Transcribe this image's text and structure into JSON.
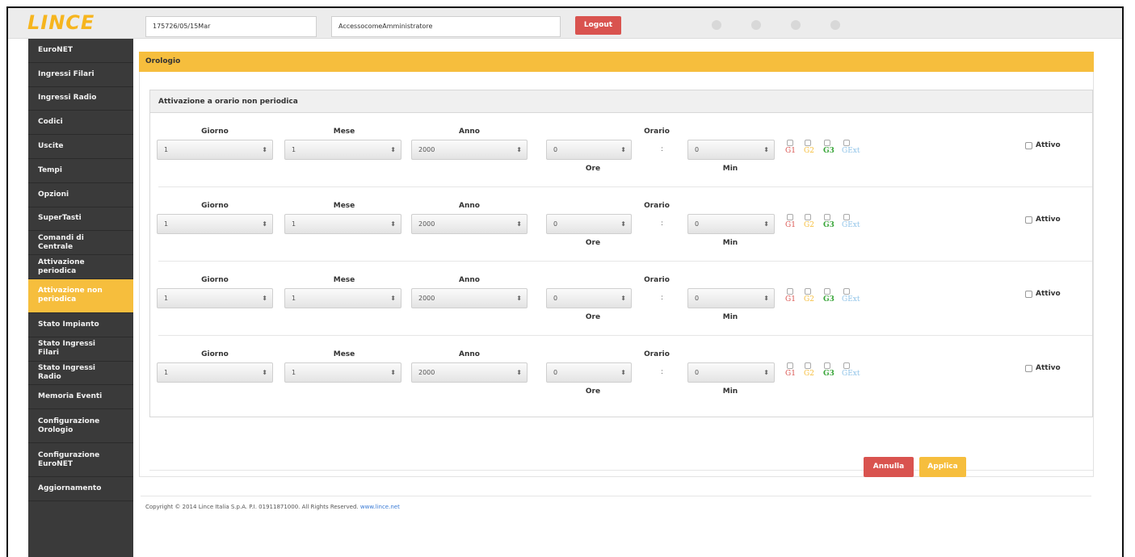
{
  "app": {
    "logo": "LINCE"
  },
  "header": {
    "field1": "175726/05/15Mar",
    "field2": "AccessocomeAmministratore",
    "logout_label": "Logout"
  },
  "sidebar": {
    "items": [
      "EuroNET",
      "Ingressi Filari",
      "Ingressi Radio",
      "Codici",
      "Uscite",
      "Tempi",
      "Opzioni",
      "SuperTasti",
      "Comandi di Centrale",
      "Attivazione periodica",
      "Attivazione non periodica",
      "Stato Impianto",
      "Stato Ingressi Filari",
      "Stato Ingressi Radio",
      "Memoria Eventi",
      "Configurazione Orologio",
      "Configurazione EuroNET",
      "Aggiornamento"
    ],
    "active_index": 10
  },
  "panel": {
    "title": "Orologio",
    "section_title": "Attivazione a orario non periodica"
  },
  "labels": {
    "giorno": "Giorno",
    "mese": "Mese",
    "anno": "Anno",
    "orario": "Orario",
    "ore": "Ore",
    "min": "Min",
    "colon": ":",
    "attivo": "Attivo",
    "g1": "G1",
    "g2": "G2",
    "g3": "G3",
    "gext": "GExt"
  },
  "rows": [
    {
      "giorno": "1",
      "mese": "1",
      "anno": "2000",
      "ore": "0",
      "min": "0"
    },
    {
      "giorno": "1",
      "mese": "1",
      "anno": "2000",
      "ore": "0",
      "min": "0"
    },
    {
      "giorno": "1",
      "mese": "1",
      "anno": "2000",
      "ore": "0",
      "min": "0"
    },
    {
      "giorno": "1",
      "mese": "1",
      "anno": "2000",
      "ore": "0",
      "min": "0"
    }
  ],
  "colors": {
    "g1": "#d9534f",
    "g2": "#f6be3d",
    "g3": "#3aa63a",
    "gext": "#8fc3e8",
    "accent": "#f6be3d",
    "danger": "#d9534f"
  },
  "actions": {
    "annulla_label": "Annulla",
    "applica_label": "Applica"
  },
  "footer": {
    "copyright": "Copyright © 2014 Lince Italia S.p.A. P.I. 01911871000. All Rights Reserved.",
    "link": "www.lince.net"
  }
}
